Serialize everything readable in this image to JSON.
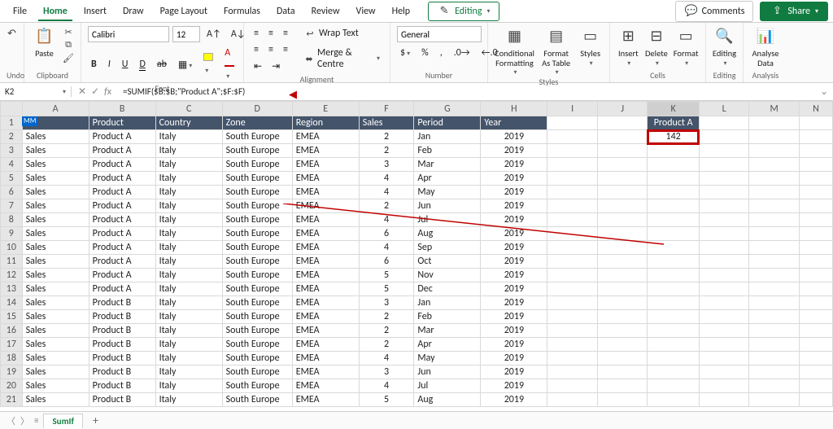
{
  "tabs": {
    "file": "File",
    "home": "Home",
    "insert": "Insert",
    "draw": "Draw",
    "pageLayout": "Page Layout",
    "formulas": "Formulas",
    "data": "Data",
    "review": "Review",
    "view": "View",
    "help": "Help"
  },
  "topButtons": {
    "editing": "Editing",
    "comments": "Comments",
    "share": "Share"
  },
  "ribbon": {
    "undo": "Undo",
    "clipboard": "Clipboard",
    "paste": "Paste",
    "font": {
      "group": "Font",
      "name": "Calibri",
      "size": "12"
    },
    "alignment": {
      "group": "Alignment",
      "wrap": "Wrap Text",
      "merge": "Merge & Centre"
    },
    "number": {
      "group": "Number",
      "format": "General"
    },
    "styles": {
      "group": "Styles",
      "cond": "Conditional Formatting",
      "fmt": "Format As Table",
      "styles": "Styles"
    },
    "cells": {
      "group": "Cells",
      "insert": "Insert",
      "delete": "Delete",
      "format": "Format"
    },
    "editing": {
      "group": "Editing",
      "label": "Editing"
    },
    "analysis": {
      "group": "Analysis",
      "label": "Analyse Data"
    }
  },
  "nameBox": "K2",
  "formula": "=SUMIF($B:$B;\"Product A\";$F:$F)",
  "columns": [
    "A",
    "B",
    "C",
    "D",
    "E",
    "F",
    "G",
    "H",
    "I",
    "J",
    "K",
    "L",
    "M",
    "N"
  ],
  "headerRow": {
    "A": "m",
    "B": "Product",
    "C": "Country",
    "D": "Zone",
    "E": "Region",
    "F": "Sales",
    "G": "Period",
    "H": "Year",
    "K": "Product A"
  },
  "rows": [
    {
      "n": 2,
      "A": "Sales",
      "B": "Product A",
      "C": "Italy",
      "D": "South Europe",
      "E": "EMEA",
      "F": "2",
      "G": "Jan",
      "H": "2019",
      "K": "142"
    },
    {
      "n": 3,
      "A": "Sales",
      "B": "Product A",
      "C": "Italy",
      "D": "South Europe",
      "E": "EMEA",
      "F": "2",
      "G": "Feb",
      "H": "2019"
    },
    {
      "n": 4,
      "A": "Sales",
      "B": "Product A",
      "C": "Italy",
      "D": "South Europe",
      "E": "EMEA",
      "F": "3",
      "G": "Mar",
      "H": "2019"
    },
    {
      "n": 5,
      "A": "Sales",
      "B": "Product A",
      "C": "Italy",
      "D": "South Europe",
      "E": "EMEA",
      "F": "4",
      "G": "Apr",
      "H": "2019"
    },
    {
      "n": 6,
      "A": "Sales",
      "B": "Product A",
      "C": "Italy",
      "D": "South Europe",
      "E": "EMEA",
      "F": "4",
      "G": "May",
      "H": "2019"
    },
    {
      "n": 7,
      "A": "Sales",
      "B": "Product A",
      "C": "Italy",
      "D": "South Europe",
      "E": "EMEA",
      "F": "2",
      "G": "Jun",
      "H": "2019"
    },
    {
      "n": 8,
      "A": "Sales",
      "B": "Product A",
      "C": "Italy",
      "D": "South Europe",
      "E": "EMEA",
      "F": "4",
      "G": "Jul",
      "H": "2019"
    },
    {
      "n": 9,
      "A": "Sales",
      "B": "Product A",
      "C": "Italy",
      "D": "South Europe",
      "E": "EMEA",
      "F": "6",
      "G": "Aug",
      "H": "2019"
    },
    {
      "n": 10,
      "A": "Sales",
      "B": "Product A",
      "C": "Italy",
      "D": "South Europe",
      "E": "EMEA",
      "F": "4",
      "G": "Sep",
      "H": "2019"
    },
    {
      "n": 11,
      "A": "Sales",
      "B": "Product A",
      "C": "Italy",
      "D": "South Europe",
      "E": "EMEA",
      "F": "6",
      "G": "Oct",
      "H": "2019"
    },
    {
      "n": 12,
      "A": "Sales",
      "B": "Product A",
      "C": "Italy",
      "D": "South Europe",
      "E": "EMEA",
      "F": "5",
      "G": "Nov",
      "H": "2019"
    },
    {
      "n": 13,
      "A": "Sales",
      "B": "Product A",
      "C": "Italy",
      "D": "South Europe",
      "E": "EMEA",
      "F": "5",
      "G": "Dec",
      "H": "2019"
    },
    {
      "n": 14,
      "A": "Sales",
      "B": "Product B",
      "C": "Italy",
      "D": "South Europe",
      "E": "EMEA",
      "F": "3",
      "G": "Jan",
      "H": "2019"
    },
    {
      "n": 15,
      "A": "Sales",
      "B": "Product B",
      "C": "Italy",
      "D": "South Europe",
      "E": "EMEA",
      "F": "2",
      "G": "Feb",
      "H": "2019"
    },
    {
      "n": 16,
      "A": "Sales",
      "B": "Product B",
      "C": "Italy",
      "D": "South Europe",
      "E": "EMEA",
      "F": "2",
      "G": "Mar",
      "H": "2019"
    },
    {
      "n": 17,
      "A": "Sales",
      "B": "Product B",
      "C": "Italy",
      "D": "South Europe",
      "E": "EMEA",
      "F": "2",
      "G": "Apr",
      "H": "2019"
    },
    {
      "n": 18,
      "A": "Sales",
      "B": "Product B",
      "C": "Italy",
      "D": "South Europe",
      "E": "EMEA",
      "F": "4",
      "G": "May",
      "H": "2019"
    },
    {
      "n": 19,
      "A": "Sales",
      "B": "Product B",
      "C": "Italy",
      "D": "South Europe",
      "E": "EMEA",
      "F": "3",
      "G": "Jun",
      "H": "2019"
    },
    {
      "n": 20,
      "A": "Sales",
      "B": "Product B",
      "C": "Italy",
      "D": "South Europe",
      "E": "EMEA",
      "F": "4",
      "G": "Jul",
      "H": "2019"
    },
    {
      "n": 21,
      "A": "Sales",
      "B": "Product B",
      "C": "Italy",
      "D": "South Europe",
      "E": "EMEA",
      "F": "5",
      "G": "Aug",
      "H": "2019"
    }
  ],
  "cornerBadge": "MM",
  "sheetTab": "SumIf"
}
